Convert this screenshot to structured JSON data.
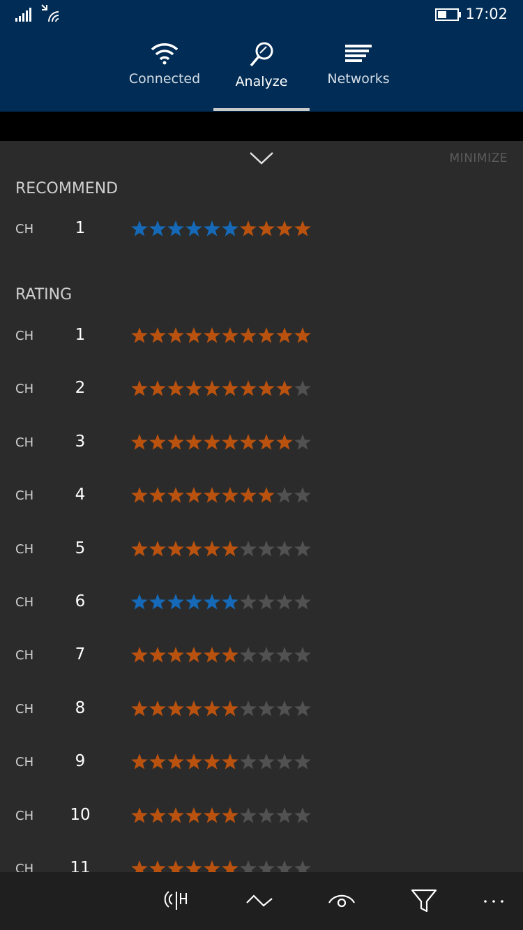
{
  "status_bar": {
    "time": "17:02",
    "icons": [
      "signal-strength-icon",
      "wifi-status-icon",
      "battery-icon"
    ]
  },
  "tabs": [
    {
      "label": "Connected",
      "icon": "wifi-icon",
      "active": false
    },
    {
      "label": "Analyze",
      "icon": "magnifier-icon",
      "active": true
    },
    {
      "label": "Networks",
      "icon": "networks-list-icon",
      "active": false
    }
  ],
  "panel": {
    "minimize_label": "MINIMIZE",
    "recommend": {
      "title": "RECOMMEND",
      "rows": [
        {
          "label": "CH",
          "channel": "1",
          "rating": 10,
          "highlight": 6
        }
      ]
    },
    "rating": {
      "title": "RATING",
      "rows": [
        {
          "label": "CH",
          "channel": "1",
          "rating": 10,
          "highlight": 0
        },
        {
          "label": "CH",
          "channel": "2",
          "rating": 9,
          "highlight": 0
        },
        {
          "label": "CH",
          "channel": "3",
          "rating": 9,
          "highlight": 0
        },
        {
          "label": "CH",
          "channel": "4",
          "rating": 8,
          "highlight": 0
        },
        {
          "label": "CH",
          "channel": "5",
          "rating": 6,
          "highlight": 0
        },
        {
          "label": "CH",
          "channel": "6",
          "rating": 6,
          "highlight": 6
        },
        {
          "label": "CH",
          "channel": "7",
          "rating": 6,
          "highlight": 0
        },
        {
          "label": "CH",
          "channel": "8",
          "rating": 6,
          "highlight": 0
        },
        {
          "label": "CH",
          "channel": "9",
          "rating": 6,
          "highlight": 0
        },
        {
          "label": "CH",
          "channel": "10",
          "rating": 6,
          "highlight": 0
        },
        {
          "label": "CH",
          "channel": "11",
          "rating": 6,
          "highlight": 0
        }
      ]
    },
    "max_stars": 10
  },
  "app_bar": {
    "buttons": [
      "signal-strength-button",
      "graph-button",
      "eye-button",
      "filter-button",
      "more-button"
    ]
  },
  "colors": {
    "header_bg": "#002c55",
    "star_orange": "#b9520f",
    "star_blue": "#1569b6",
    "star_empty": "#515151",
    "panel_bg": "#2b2b2b",
    "app_bar_bg": "#1f1f1f"
  }
}
